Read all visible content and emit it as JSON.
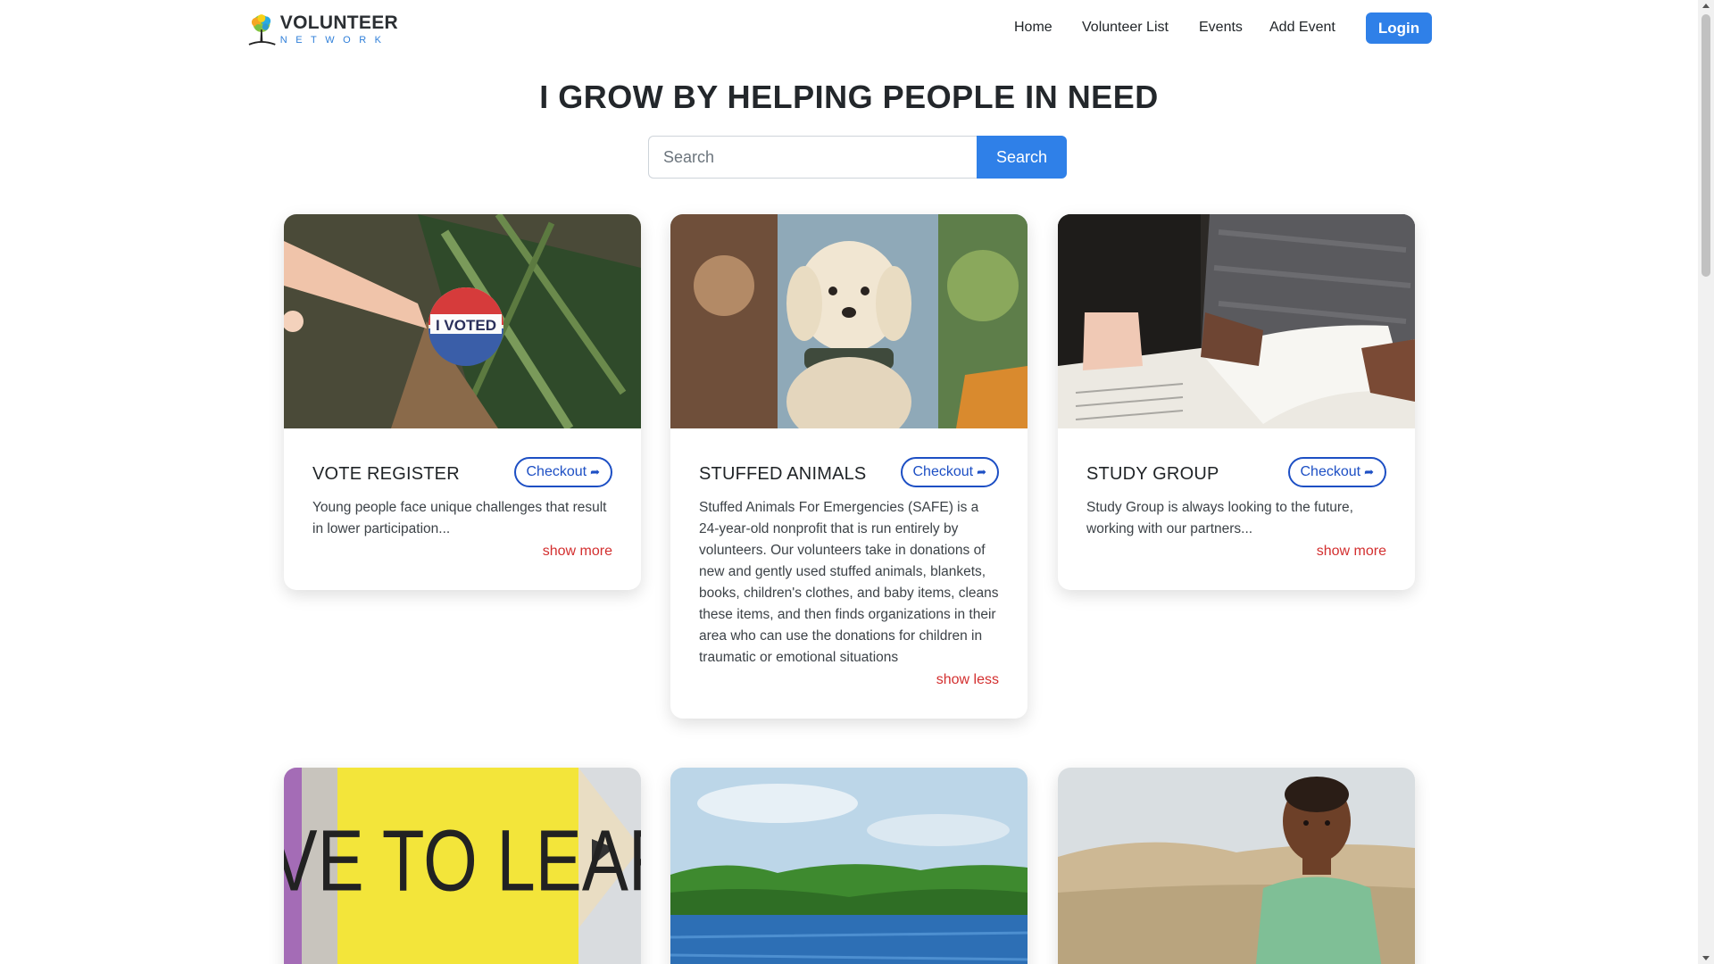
{
  "brand": {
    "name": "VOLUNTEER",
    "tagline": "NETWORK"
  },
  "nav": {
    "items": [
      "Home",
      "Volunteer List",
      "Events",
      "Add Event"
    ],
    "login_label": "Login"
  },
  "headline": "I GROW BY HELPING PEOPLE IN NEED",
  "search": {
    "placeholder": "Search",
    "button_label": "Search"
  },
  "cards": [
    {
      "title": "VOTE REGISTER",
      "checkout_label": "Checkout",
      "description": "Young people face unique challenges that result in lower participation...",
      "toggle_label": "show more",
      "image_icon": "i-voted-sticker-image"
    },
    {
      "title": "STUFFED ANIMALS",
      "checkout_label": "Checkout",
      "description": "Stuffed Animals For Emergencies (SAFE) is a 24-year-old nonprofit that is run entirely by volunteers. Our volunteers take in donations of new and gently used stuffed animals, blankets, books, children's clothes, and baby items, cleans these items, and then finds organizations in their area who can use the donations for children in traumatic or emotional situations",
      "toggle_label": "show less",
      "image_icon": "dog-image"
    },
    {
      "title": "STUDY GROUP",
      "checkout_label": "Checkout",
      "description": "Study Group is always looking to the future, working with our partners...",
      "toggle_label": "show more",
      "image_icon": "book-study-image"
    }
  ],
  "bottom_cards": [
    {
      "image_icon": "love-to-learn-pencil-image",
      "image_text": "LOVE TO LEARN"
    },
    {
      "image_icon": "river-landscape-image"
    },
    {
      "image_icon": "child-portrait-image"
    }
  ],
  "colors": {
    "primary": "#2f80e8",
    "checkout_border": "#1d4fc4",
    "toggle_red": "#d32f2f",
    "brand_blue": "#2f7fd9"
  }
}
